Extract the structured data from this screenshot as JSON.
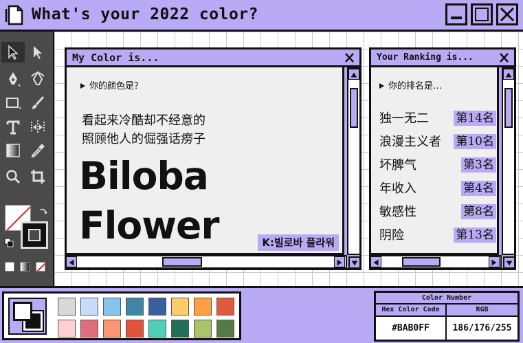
{
  "app": {
    "title": "What's your 2022 color?"
  },
  "window_controls": [
    "minimize",
    "maximize",
    "close"
  ],
  "tools": [
    "selection-tool",
    "direct-selection-tool",
    "pen-tool",
    "curvature-tool",
    "rectangle-tool",
    "paintbrush-tool",
    "type-tool",
    "width-tool",
    "gradient-tool",
    "eyedropper-tool",
    "zoom-tool",
    "crop-tool"
  ],
  "my_color": {
    "title": "My Color is...",
    "close": "X",
    "prompt": "你的颜色是？",
    "desc_line1": "看起来冷酷却不经意的",
    "desc_line2": "照顾他人的倔强话痨子",
    "name": "Biloba Flower",
    "korean": "K:빌로바 플라워"
  },
  "ranking": {
    "title": "Your Ranking is...",
    "close": "X",
    "prompt": "你的排名是…",
    "items": [
      {
        "label": "独一无二",
        "rank": "第14名"
      },
      {
        "label": "浪漫主义者",
        "rank": "第10名"
      },
      {
        "label": "坏脾气",
        "rank": "第3名"
      },
      {
        "label": "年收入",
        "rank": "第4名"
      },
      {
        "label": "敏感性",
        "rank": "第8名"
      },
      {
        "label": "阴险",
        "rank": "第13名"
      }
    ]
  },
  "swatches": {
    "row1": [
      "#d8d8d8",
      "#c5dcff",
      "#86c3ee",
      "#3e86a7",
      "#3a5fa0",
      "#ffcb6b",
      "#ffa043",
      "#e05a3f"
    ],
    "row2": [
      "#ffd0d0",
      "#df6e7a",
      "#ff9470",
      "#e2533b",
      "#4fcfb6",
      "#1f7057",
      "#a8c56a",
      "#567a45"
    ]
  },
  "color_number": {
    "header": "Color Number",
    "hex_label": "Hex Color Code",
    "rgb_label": "RGB",
    "hex": "#BAB0FF",
    "rgb": "186/176/255"
  },
  "colors": {
    "accent": "#b8aaf5",
    "panel": "#efefef",
    "toolbar": "#4a4a4a"
  }
}
